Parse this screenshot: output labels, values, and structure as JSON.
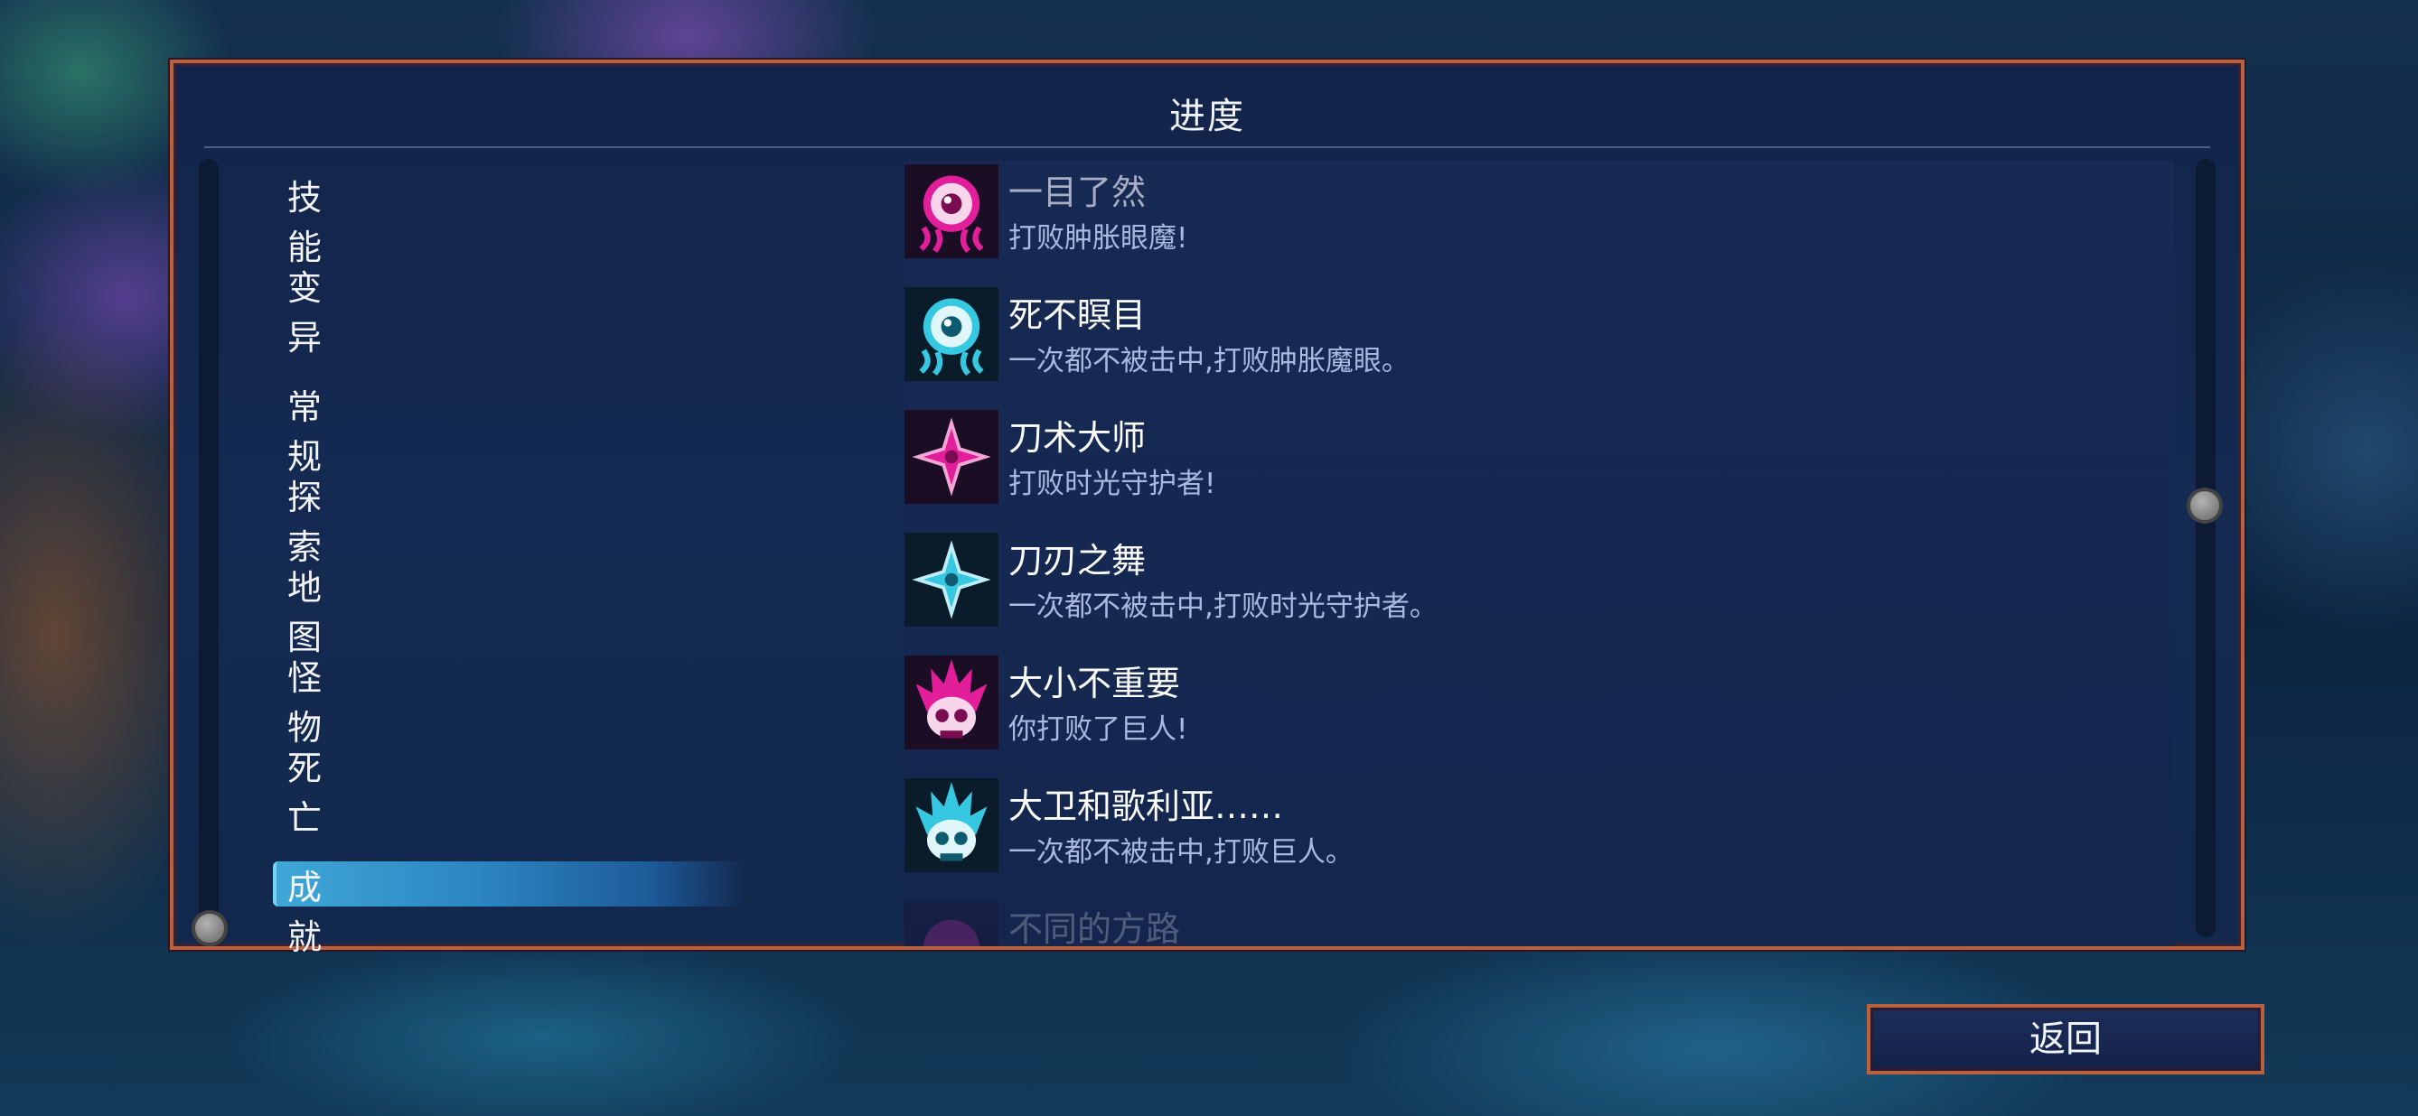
{
  "title": "进度",
  "nav": {
    "items": [
      {
        "label": "技能"
      },
      {
        "label": "变异"
      },
      {
        "label": "常规"
      },
      {
        "label": "探索"
      },
      {
        "label": "地图"
      },
      {
        "label": "怪物"
      },
      {
        "label": "死亡"
      },
      {
        "label": "成就"
      }
    ],
    "selected": "成就"
  },
  "achievements": [
    {
      "name": "一目了然",
      "desc": "打败肿胀眼魔!",
      "icon": "eye-monster-icon",
      "color": "#e21e9a",
      "state": "faded"
    },
    {
      "name": "死不瞑目",
      "desc": "一次都不被击中,打败肿胀魔眼。",
      "icon": "eye-monster-icon",
      "color": "#36c8e0",
      "state": "normal"
    },
    {
      "name": "刀术大师",
      "desc": "打败时光守护者!",
      "icon": "shuriken-icon",
      "color": "#e21e9a",
      "state": "normal"
    },
    {
      "name": "刀刃之舞",
      "desc": "一次都不被击中,打败时光守护者。",
      "icon": "shuriken-icon",
      "color": "#36c8e0",
      "state": "normal"
    },
    {
      "name": "大小不重要",
      "desc": "你打败了巨人!",
      "icon": "giant-skull-icon",
      "color": "#e21e9a",
      "state": "normal"
    },
    {
      "name": "大卫和歌利亚……",
      "desc": "一次都不被击中,打败巨人。",
      "icon": "giant-skull-icon",
      "color": "#36c8e0",
      "state": "normal"
    },
    {
      "name": "不同的方路",
      "desc": "",
      "icon": "achievement-icon",
      "color": "#e21e9a",
      "state": "ghost"
    }
  ],
  "back_label": "返回"
}
